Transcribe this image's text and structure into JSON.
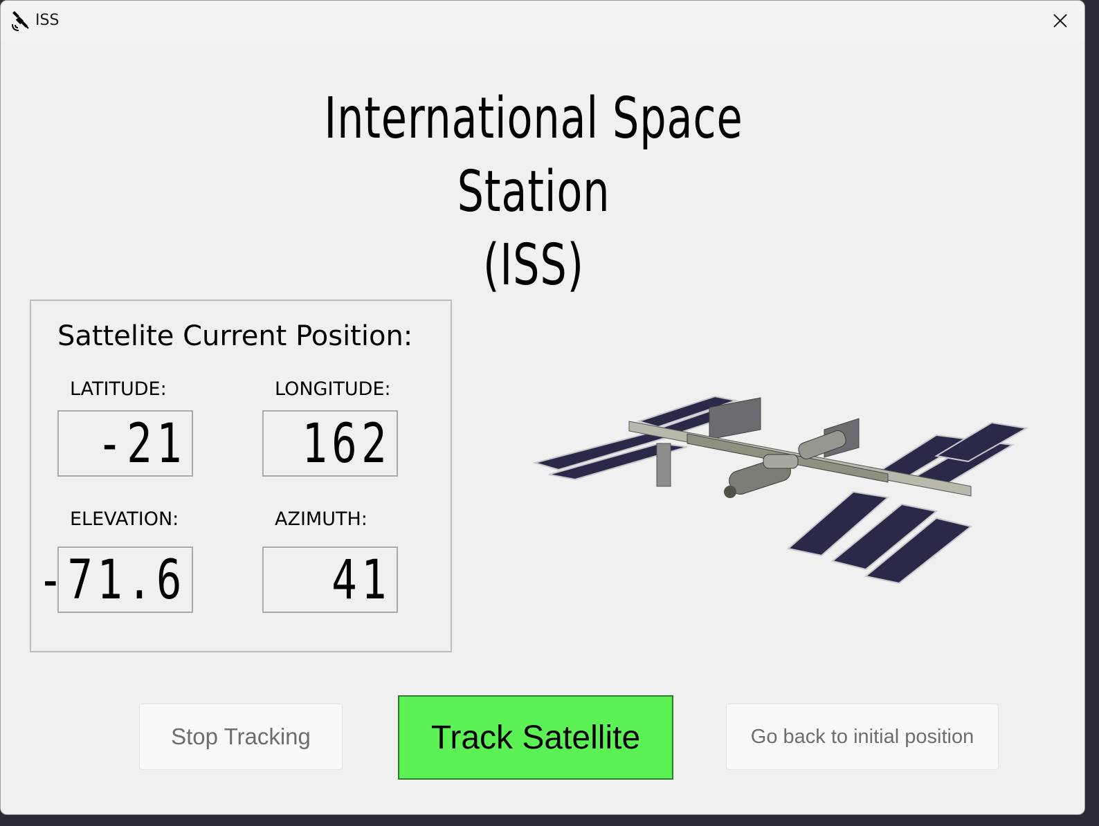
{
  "window": {
    "title": "ISS",
    "icon": "satellite-icon",
    "close_icon": "close-icon"
  },
  "header": {
    "title_line1": "International Space Station",
    "title_line2": "(ISS)"
  },
  "position_panel": {
    "heading": "Sattelite Current Position:",
    "latitude": {
      "label": "LATITUDE:",
      "value": "-21"
    },
    "longitude": {
      "label": "LONGITUDE:",
      "value": "162"
    },
    "elevation": {
      "label": "ELEVATION:",
      "value": "-71.6"
    },
    "azimuth": {
      "label": "AZIMUTH:",
      "value": "41"
    }
  },
  "image": {
    "icon": "iss-station-image"
  },
  "buttons": {
    "stop": "Stop Tracking",
    "track": "Track Satellite",
    "reset": "Go back to initial position"
  },
  "colors": {
    "track_button": "#5cf255",
    "background": "#f0f0f0"
  }
}
